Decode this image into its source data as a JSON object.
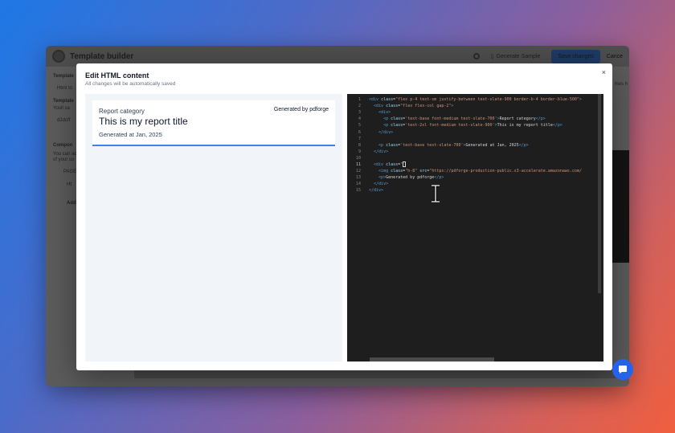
{
  "app": {
    "title": "Template builder",
    "generate_sample_label": "Generate Sample",
    "save_changes_label": "Save changes",
    "cancel_label": "Cance",
    "sidebar_labels": [
      "Template",
      "Html to",
      "Template",
      "Youll sa",
      "d2dcff",
      "Compon",
      "You can ad",
      "of your co",
      "PAGE",
      "Ht",
      "Add"
    ],
    "right_panel_labels": [
      "mes h"
    ]
  },
  "modal": {
    "title": "Edit HTML content",
    "subtitle": "All changes will be automatically saved",
    "close_label": "×"
  },
  "preview": {
    "category": "Report category",
    "generated_by": "Generated by pdforge",
    "title": "This is my report title",
    "date": "Generated at Jan, 2025"
  },
  "code_editor": {
    "active_line": 11,
    "lines": [
      {
        "n": "1",
        "html": "<span class=\"tag\">&lt;div</span> <span class=\"attr\">class</span>=<span class=\"str\">\"flex p-4 text-sm justify-between text-slate-900 border-b-4 border-blue-500\"</span><span class=\"tag\">&gt;</span>"
      },
      {
        "n": "2",
        "html": "  <span class=\"tag\">&lt;div</span> <span class=\"attr\">class</span>=<span class=\"str\">\"flex flex-col gap-2\"</span><span class=\"tag\">&gt;</span>"
      },
      {
        "n": "3",
        "html": "    <span class=\"tag\">&lt;div&gt;</span>"
      },
      {
        "n": "4",
        "html": "      <span class=\"tag\">&lt;p</span> <span class=\"attr\">class</span>=<span class=\"str\">'text-base font-medium text-slate-700'</span><span class=\"tag\">&gt;</span><span class=\"txt\">Report category</span><span class=\"tag\">&lt;/p&gt;</span>"
      },
      {
        "n": "5",
        "html": "      <span class=\"tag\">&lt;p</span> <span class=\"attr\">class</span>=<span class=\"str\">'text-2xl font-medium text-slate-900'</span><span class=\"tag\">&gt;</span><span class=\"txt\">This is my report title</span><span class=\"tag\">&lt;/p&gt;</span>"
      },
      {
        "n": "6",
        "html": "    <span class=\"tag\">&lt;/div&gt;</span>"
      },
      {
        "n": "7",
        "html": ""
      },
      {
        "n": "8",
        "html": "    <span class=\"tag\">&lt;p</span> <span class=\"attr\">class</span>=<span class=\"str\">'text-base text-slate-700'</span><span class=\"tag\">&gt;</span><span class=\"txt\">Generated at Jan, 2025</span><span class=\"tag\">&lt;/p&gt;</span>"
      },
      {
        "n": "9",
        "html": "  <span class=\"tag\">&lt;/div&gt;</span>"
      },
      {
        "n": "10",
        "html": ""
      },
      {
        "n": "11",
        "html": "  <span class=\"tag\">&lt;div</span> <span class=\"attr\">class</span>=<span class=\"str\">\"</span><span class=\"cursor-box\"></span>"
      },
      {
        "n": "12",
        "html": "    <span class=\"tag\">&lt;img</span> <span class=\"attr\">class</span>=<span class=\"str\">\"h-8\"</span> <span class=\"attr\">src</span>=<span class=\"str\">\"https://pdforge-production-public.s3-accelerate.amazonaws.com/</span>"
      },
      {
        "n": "13",
        "html": "    <span class=\"tag\">&lt;p&gt;</span><span class=\"txt\">Generated by pdforge</span><span class=\"tag\">&lt;/p&gt;</span>"
      },
      {
        "n": "14",
        "html": "  <span class=\"tag\">&lt;/div&gt;</span>"
      },
      {
        "n": "15",
        "html": "<span class=\"tag\">&lt;/div&gt;</span>"
      }
    ]
  },
  "colors": {
    "accent": "#3b82f6",
    "chat_button": "#2563eb",
    "editor_bg": "#1e1e1e"
  }
}
